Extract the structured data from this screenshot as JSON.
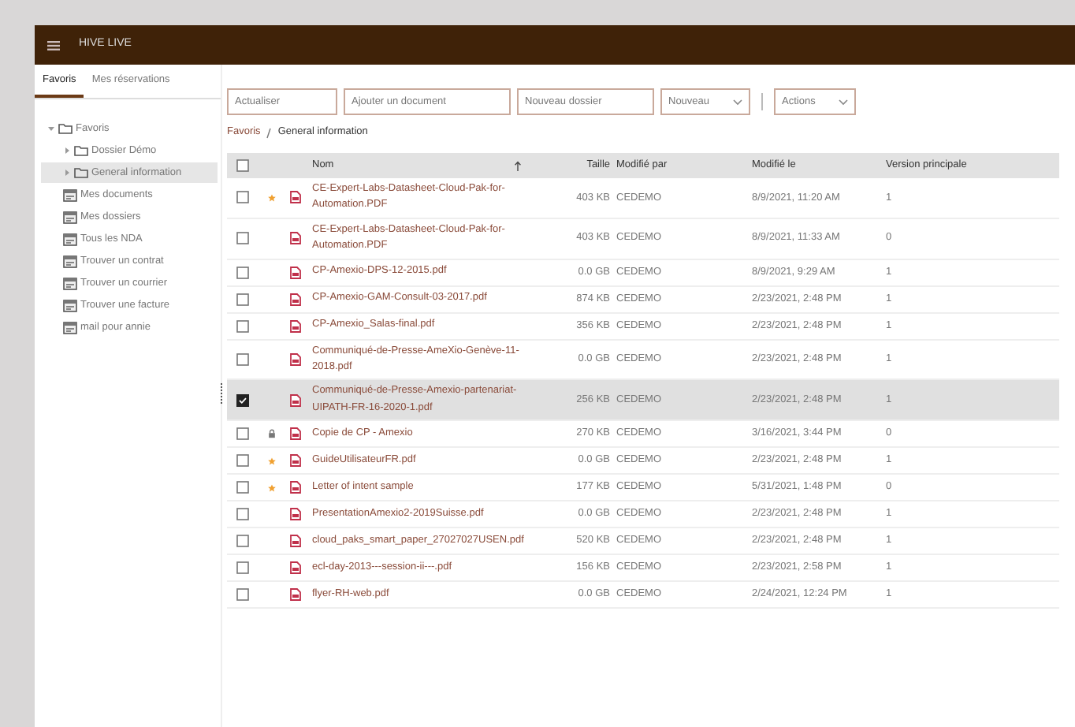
{
  "app_bar": {
    "title": "HIVE LIVE"
  },
  "tabs": [
    {
      "label": "Favoris",
      "selected": true
    },
    {
      "label": "Mes réservations",
      "selected": false
    }
  ],
  "tree": [
    {
      "label": "Favoris",
      "kind": "folder",
      "expanded": true,
      "selected": false,
      "children": [
        {
          "label": "Dossier Démo",
          "kind": "folder",
          "expanded": false,
          "selected": false
        },
        {
          "label": "General information",
          "kind": "folder",
          "expanded": false,
          "selected": true
        },
        {
          "label": "Mes documents",
          "kind": "query",
          "selected": false
        },
        {
          "label": "Mes dossiers",
          "kind": "query",
          "selected": false
        },
        {
          "label": "Tous les NDA",
          "kind": "query",
          "selected": false
        },
        {
          "label": "Trouver un contrat",
          "kind": "query",
          "selected": false
        },
        {
          "label": "Trouver un courrier",
          "kind": "query",
          "selected": false
        },
        {
          "label": "Trouver une facture",
          "kind": "query",
          "selected": false
        },
        {
          "label": "mail pour annie",
          "kind": "query",
          "selected": false
        }
      ]
    }
  ],
  "toolbar": [
    {
      "label": "Actualiser",
      "kind": "button"
    },
    {
      "label": "Ajouter un document",
      "kind": "button"
    },
    {
      "label": "Nouveau dossier",
      "kind": "button"
    },
    {
      "label": "Nouveau",
      "kind": "dropdown"
    },
    {
      "label": "Actions",
      "kind": "dropdown"
    }
  ],
  "breadcrumb": [
    "Favoris",
    "General information"
  ],
  "table": {
    "select_all_checked": false,
    "columns": [
      "Nom",
      "Taille",
      "Modifié par",
      "Modifié le",
      "Version principale"
    ],
    "rows": [
      {
        "name": "CE-Expert-Labs-Datasheet-Cloud-Pak-for-Automation.PDF",
        "size": "403 KB",
        "modified_by": "CEDEMO",
        "modified_on": "8/9/2021, 11:20 AM",
        "version": "1",
        "checked": false,
        "starred": true,
        "locked": false
      },
      {
        "name": "CE-Expert-Labs-Datasheet-Cloud-Pak-for-Automation.PDF",
        "size": "403 KB",
        "modified_by": "CEDEMO",
        "modified_on": "8/9/2021, 11:33 AM",
        "version": "0",
        "checked": false,
        "starred": false,
        "locked": false
      },
      {
        "name": "CP-Amexio-DPS-12-2015.pdf",
        "size": "0.0 GB",
        "modified_by": "CEDEMO",
        "modified_on": "8/9/2021, 9:29 AM",
        "version": "1",
        "checked": false,
        "starred": false,
        "locked": false
      },
      {
        "name": "CP-Amexio-GAM-Consult-03-2017.pdf",
        "size": "874 KB",
        "modified_by": "CEDEMO",
        "modified_on": "2/23/2021, 2:48 PM",
        "version": "1",
        "checked": false,
        "starred": false,
        "locked": false
      },
      {
        "name": "CP-Amexio_Salas-final.pdf",
        "size": "356 KB",
        "modified_by": "CEDEMO",
        "modified_on": "2/23/2021, 2:48 PM",
        "version": "1",
        "checked": false,
        "starred": false,
        "locked": false
      },
      {
        "name": "Communiqué-de-Presse-AmeXio-Genève-11-2018.pdf",
        "size": "0.0 GB",
        "modified_by": "CEDEMO",
        "modified_on": "2/23/2021, 2:48 PM",
        "version": "1",
        "checked": false,
        "starred": false,
        "locked": false
      },
      {
        "name": "Communiqué-de-Presse-Amexio-partenariat-UIPATH-FR-16-2020-1.pdf",
        "size": "256 KB",
        "modified_by": "CEDEMO",
        "modified_on": "2/23/2021, 2:48 PM",
        "version": "1",
        "checked": true,
        "starred": false,
        "locked": false
      },
      {
        "name": "Copie de CP - Amexio",
        "size": "270 KB",
        "modified_by": "CEDEMO",
        "modified_on": "3/16/2021, 3:44 PM",
        "version": "0",
        "checked": false,
        "starred": false,
        "locked": true
      },
      {
        "name": "GuideUtilisateurFR.pdf",
        "size": "0.0 GB",
        "modified_by": "CEDEMO",
        "modified_on": "2/23/2021, 2:48 PM",
        "version": "1",
        "checked": false,
        "starred": true,
        "locked": false
      },
      {
        "name": "Letter of intent sample",
        "size": "177 KB",
        "modified_by": "CEDEMO",
        "modified_on": "5/31/2021, 1:48 PM",
        "version": "0",
        "checked": false,
        "starred": true,
        "locked": false
      },
      {
        "name": "PresentationAmexio2-2019Suisse.pdf",
        "size": "0.0 GB",
        "modified_by": "CEDEMO",
        "modified_on": "2/23/2021, 2:48 PM",
        "version": "1",
        "checked": false,
        "starred": false,
        "locked": false
      },
      {
        "name": "cloud_paks_smart_paper_27027027USEN.pdf",
        "size": "520 KB",
        "modified_by": "CEDEMO",
        "modified_on": "2/23/2021, 2:48 PM",
        "version": "1",
        "checked": false,
        "starred": false,
        "locked": false
      },
      {
        "name": "ecl-day-2013---session-ii---.pdf",
        "size": "156 KB",
        "modified_by": "CEDEMO",
        "modified_on": "2/23/2021, 2:58 PM",
        "version": "1",
        "checked": false,
        "starred": false,
        "locked": false
      },
      {
        "name": "flyer-RH-web.pdf",
        "size": "0.0 GB",
        "modified_by": "CEDEMO",
        "modified_on": "2/24/2021, 12:24 PM",
        "version": "1",
        "checked": false,
        "starred": false,
        "locked": false
      }
    ]
  }
}
